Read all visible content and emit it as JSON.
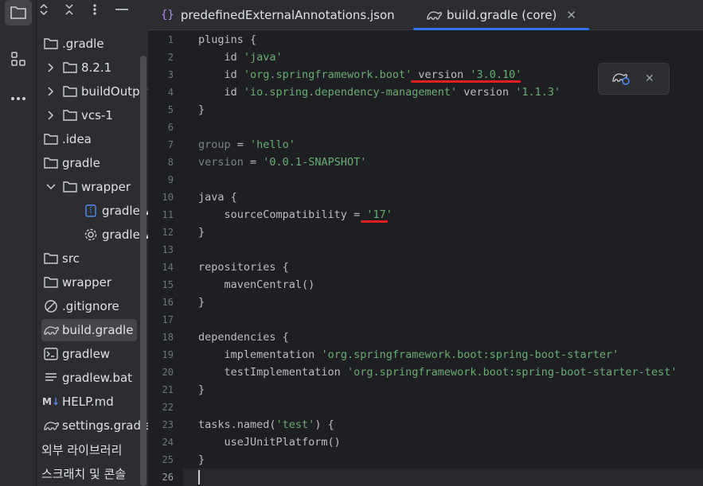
{
  "sidebar": {
    "items": [
      {
        "label": ".gradle",
        "icon": "folder-icon",
        "level": 0,
        "chevron": ""
      },
      {
        "label": "8.2.1",
        "icon": "folder-icon",
        "level": 1,
        "chevron": "collapsed"
      },
      {
        "label": "buildOutputCleanup",
        "icon": "folder-icon",
        "level": 1,
        "chevron": "collapsed"
      },
      {
        "label": "vcs-1",
        "icon": "folder-icon",
        "level": 1,
        "chevron": "collapsed"
      },
      {
        "label": ".idea",
        "icon": "folder-icon",
        "level": 0,
        "chevron": ""
      },
      {
        "label": "gradle",
        "icon": "folder-icon",
        "level": 0,
        "chevron": ""
      },
      {
        "label": "wrapper",
        "icon": "folder-icon",
        "level": 1,
        "chevron": "expanded"
      },
      {
        "label": "gradle-wrapper.jar",
        "icon": "archive-icon",
        "level": 2,
        "chevron": ""
      },
      {
        "label": "gradle-wrapper.properties",
        "icon": "settings-gear-icon",
        "level": 2,
        "chevron": ""
      },
      {
        "label": "src",
        "icon": "folder-icon",
        "level": 0,
        "chevron": ""
      },
      {
        "label": "wrapper",
        "icon": "folder-icon",
        "level": 0,
        "chevron": ""
      },
      {
        "label": ".gitignore",
        "icon": "ignore-icon",
        "level": 0,
        "chevron": ""
      },
      {
        "label": "build.gradle",
        "icon": "gradle-elephant-icon",
        "level": 0,
        "chevron": "",
        "selected": true
      },
      {
        "label": "gradlew",
        "icon": "terminal-icon",
        "level": 0,
        "chevron": ""
      },
      {
        "label": "gradlew.bat",
        "icon": "text-file-icon",
        "level": 0,
        "chevron": ""
      },
      {
        "label": "HELP.md",
        "icon": "markdown-icon",
        "level": 0,
        "chevron": ""
      },
      {
        "label": "settings.gradle",
        "icon": "gradle-elephant-icon",
        "level": 0,
        "chevron": ""
      },
      {
        "label": "외부 라이브러리",
        "icon": "library-icon",
        "level": -1,
        "chevron": ""
      },
      {
        "label": "스크래치 및 콘솔",
        "icon": "scratch-icon",
        "level": -1,
        "chevron": ""
      }
    ]
  },
  "tabs": [
    {
      "label": "predefinedExternalAnnotations.json",
      "icon": "json-braces-icon",
      "active": false
    },
    {
      "label": "build.gradle (core)",
      "icon": "gradle-elephant-icon",
      "active": true
    }
  ],
  "editor": {
    "lines": [
      "plugins {",
      "    id 'java'",
      "    id 'org.springframework.boot' version '3.0.10'",
      "    id 'io.spring.dependency-management' version '1.1.3'",
      "}",
      "",
      "group = 'hello'",
      "version = '0.0.1-SNAPSHOT'",
      "",
      "java {",
      "    sourceCompatibility = '17'",
      "}",
      "",
      "repositories {",
      "    mavenCentral()",
      "}",
      "",
      "dependencies {",
      "    implementation 'org.springframework.boot:spring-boot-starter'",
      "    testImplementation 'org.springframework.boot:spring-boot-starter-test'",
      "}",
      "",
      "tasks.named('test') {",
      "    useJUnitPlatform()",
      "}",
      ""
    ],
    "current_line": 26
  },
  "colors": {
    "accent": "#3574f0",
    "string": "#6aab73",
    "annotation_underline": "#e02020"
  }
}
